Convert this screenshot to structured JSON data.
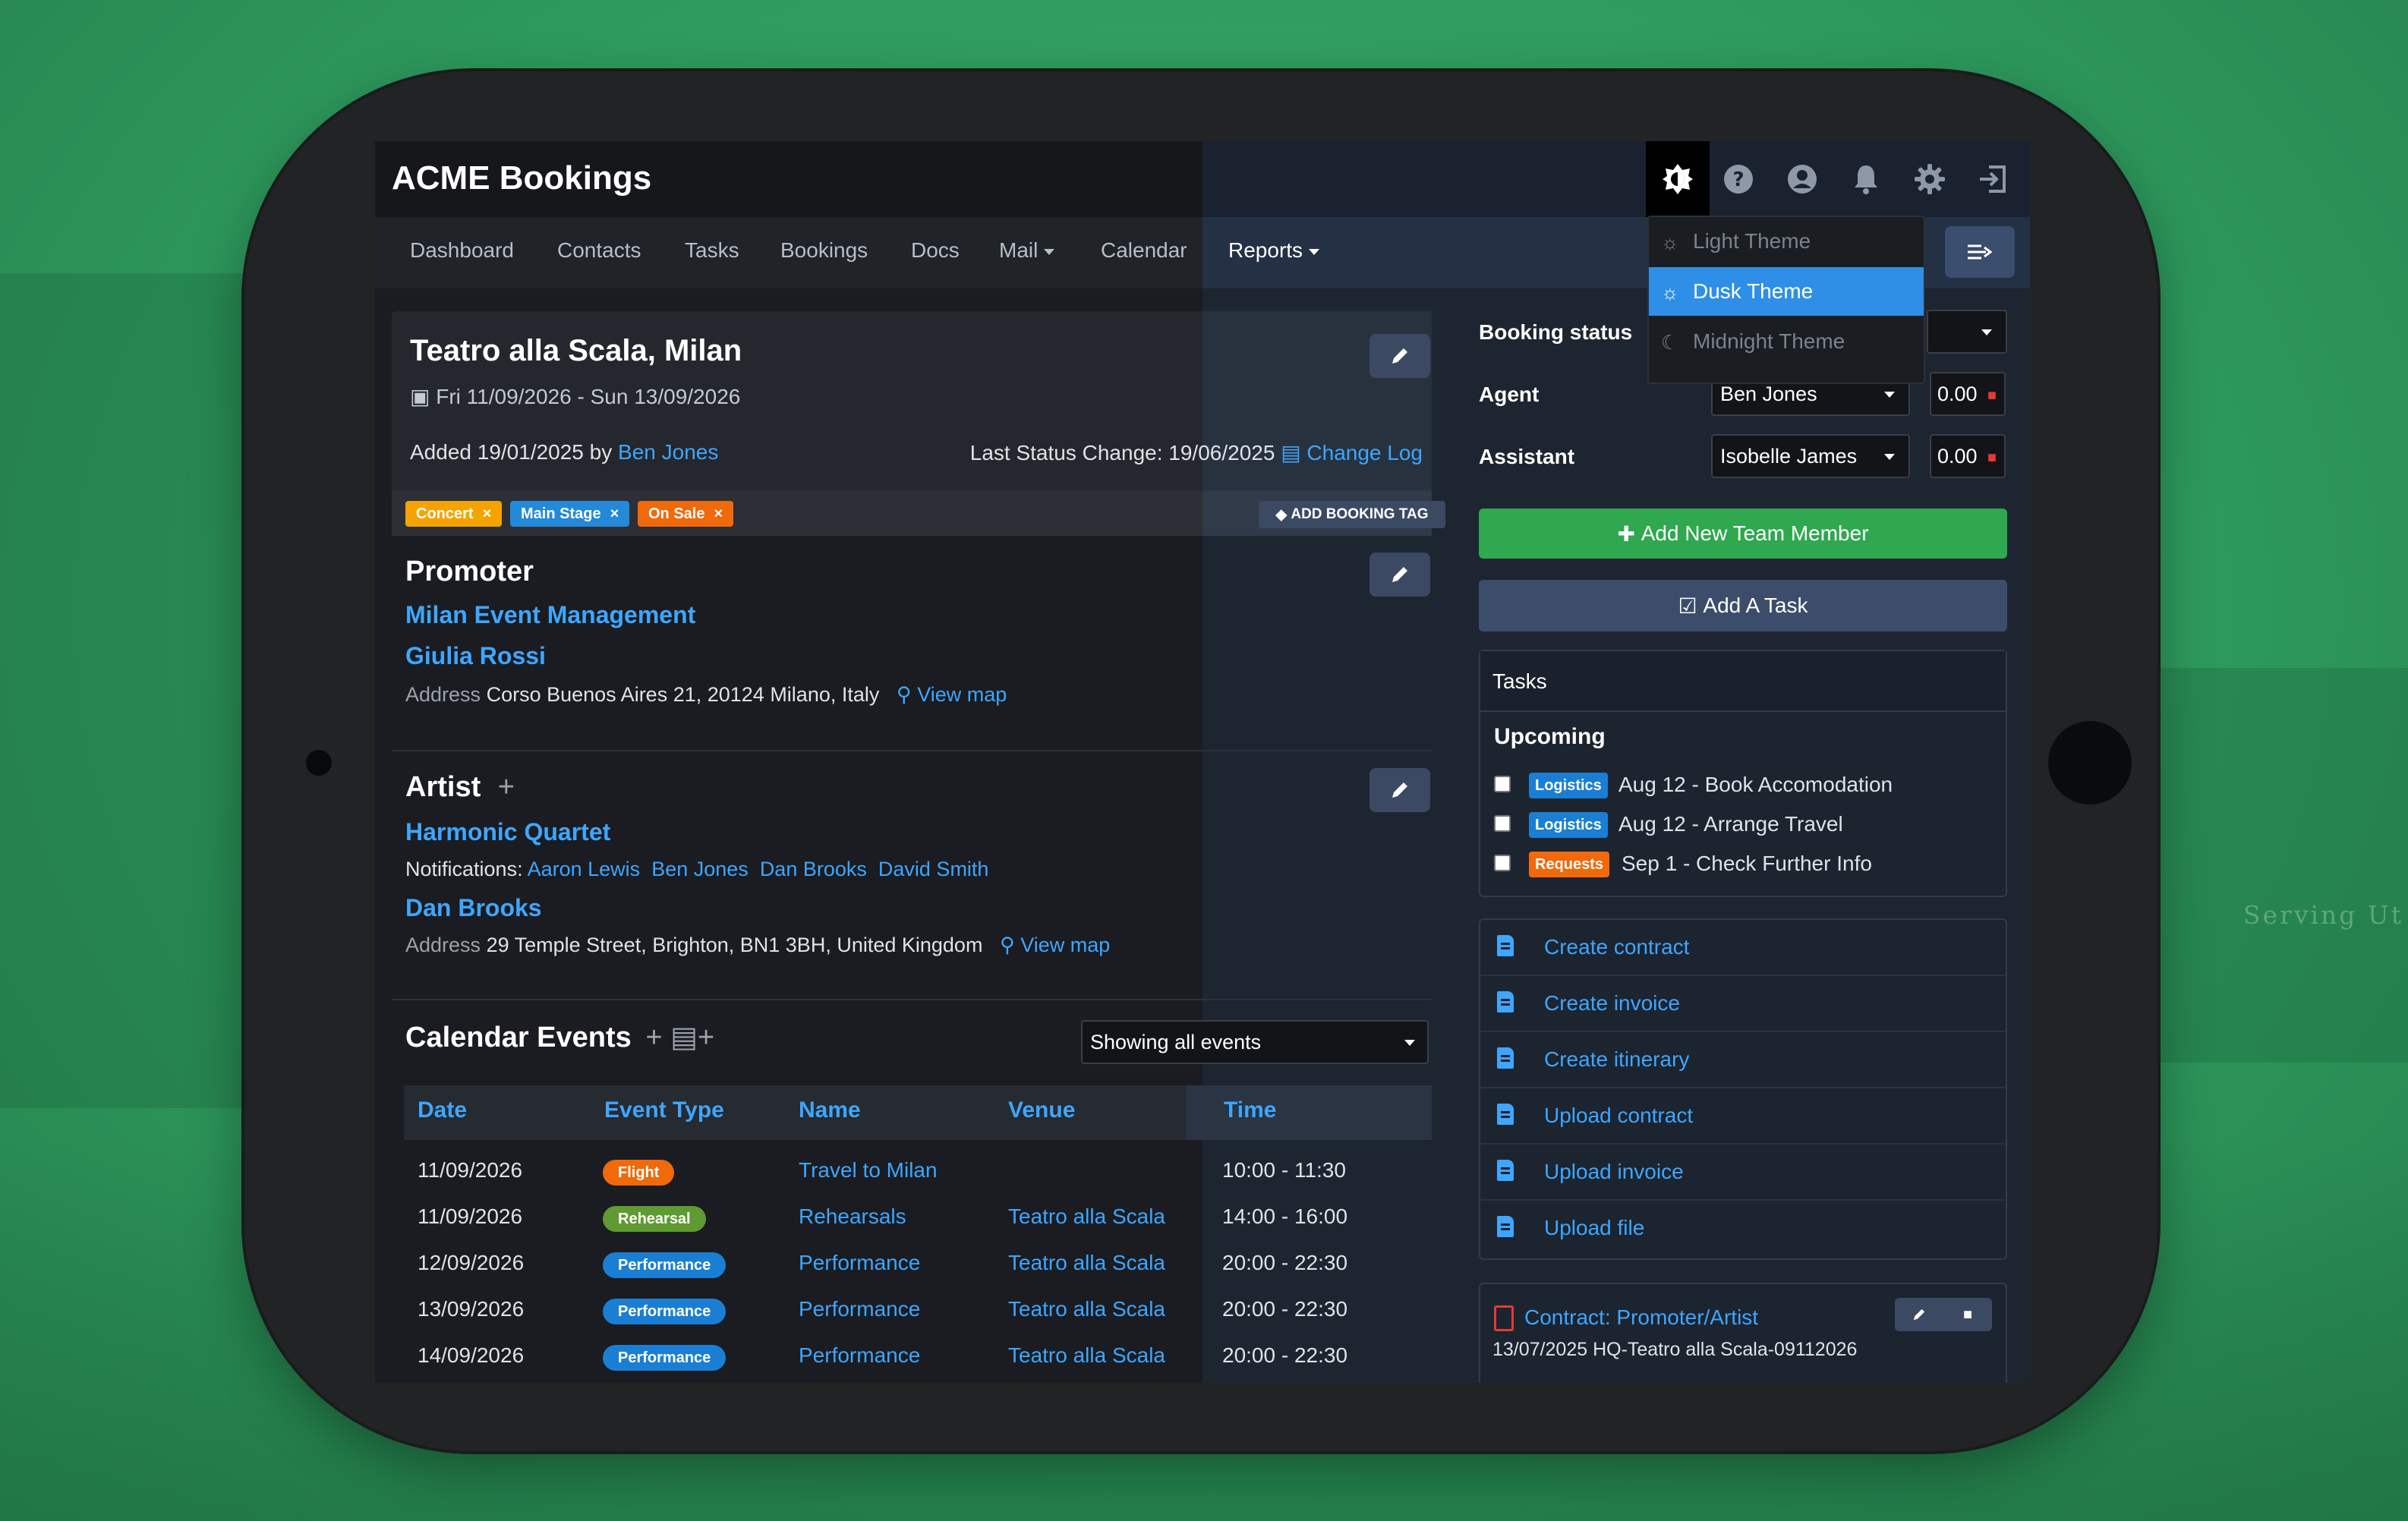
{
  "app": {
    "title": "ACME Bookings"
  },
  "header_icons": [
    "theme-icon",
    "help-icon",
    "user-icon",
    "bell-icon",
    "gear-icon",
    "logout-icon"
  ],
  "nav": {
    "items": [
      {
        "label": "Dashboard"
      },
      {
        "label": "Contacts"
      },
      {
        "label": "Tasks"
      },
      {
        "label": "Bookings"
      },
      {
        "label": "Docs"
      },
      {
        "label": "Mail"
      },
      {
        "label": "Calendar"
      },
      {
        "label": "Reports"
      }
    ]
  },
  "theme_menu": {
    "items": [
      {
        "label": "Light Theme"
      },
      {
        "label": "Dusk Theme",
        "selected": true
      },
      {
        "label": "Midnight Theme"
      }
    ]
  },
  "booking": {
    "title": "Teatro alla Scala, Milan",
    "dates": "Fri 11/09/2026 - Sun 13/09/2026",
    "added_prefix": "Added 19/01/2025 by",
    "added_by": "Ben Jones",
    "last_status": "Last Status Change: 19/06/2025",
    "change_log": "Change Log"
  },
  "tags": [
    {
      "label": "Concert",
      "color": "#f5a300"
    },
    {
      "label": "Main Stage",
      "color": "#2389d8"
    },
    {
      "label": "On Sale",
      "color": "#f0690a"
    }
  ],
  "add_tag_label": "ADD BOOKING TAG",
  "promoter": {
    "title": "Promoter",
    "company": "Milan Event Management",
    "contact": "Giulia Rossi",
    "address_label": "Address",
    "address": "Corso Buenos Aires 21, 20124 Milano, Italy",
    "view_map": "View map"
  },
  "artist": {
    "title": "Artist",
    "name": "Harmonic Quartet",
    "notifications_label": "Notifications:",
    "notifications": [
      "Aaron Lewis",
      "Ben Jones",
      "Dan Brooks",
      "David Smith"
    ],
    "contact": "Dan Brooks",
    "address_label": "Address",
    "address": "29 Temple Street, Brighton, BN1 3BH, United Kingdom",
    "view_map": "View map"
  },
  "calendar": {
    "title": "Calendar Events",
    "filter": "Showing all events",
    "columns": [
      "Date",
      "Event Type",
      "Name",
      "Venue",
      "Time"
    ],
    "rows": [
      {
        "date": "11/09/2026",
        "type": "Flight",
        "type_color": "#f0690a",
        "name": "Travel to Milan",
        "venue": "",
        "time": "10:00 - 11:30"
      },
      {
        "date": "11/09/2026",
        "type": "Rehearsal",
        "type_color": "#5f9a32",
        "name": "Rehearsals",
        "venue": "Teatro alla Scala",
        "time": "14:00 - 16:00"
      },
      {
        "date": "12/09/2026",
        "type": "Performance",
        "type_color": "#1a7fd4",
        "name": "Performance",
        "venue": "Teatro alla Scala",
        "time": "20:00 - 22:30"
      },
      {
        "date": "13/09/2026",
        "type": "Performance",
        "type_color": "#1a7fd4",
        "name": "Performance",
        "venue": "Teatro alla Scala",
        "time": "20:00 - 22:30"
      },
      {
        "date": "14/09/2026",
        "type": "Performance",
        "type_color": "#1a7fd4",
        "name": "Performance",
        "venue": "Teatro alla Scala",
        "time": "20:00 - 22:30"
      }
    ]
  },
  "side": {
    "booking_status_label": "Booking status",
    "agent_label": "Agent",
    "agent_value": "Ben Jones",
    "agent_amount": "0.00",
    "assistant_label": "Assistant",
    "assistant_value": "Isobelle James",
    "assistant_amount": "0.00",
    "add_team_member": "Add New Team Member",
    "add_task": "Add A Task"
  },
  "tasks": {
    "title": "Tasks",
    "upcoming_label": "Upcoming",
    "items": [
      {
        "badge": "Logistics",
        "badge_color": "#1a7fd4",
        "text": "Aug 12 - Book Accomodation"
      },
      {
        "badge": "Logistics",
        "badge_color": "#1a7fd4",
        "text": "Aug 12 - Arrange Travel"
      },
      {
        "badge": "Requests",
        "badge_color": "#f0690a",
        "text": "Sep 1 - Check Further Info"
      }
    ]
  },
  "doc_actions": [
    {
      "label": "Create contract"
    },
    {
      "label": "Create invoice"
    },
    {
      "label": "Create itinerary"
    },
    {
      "label": "Upload contract"
    },
    {
      "label": "Upload invoice"
    },
    {
      "label": "Upload file"
    }
  ],
  "contract": {
    "title": "Contract: Promoter/Artist",
    "subtitle": "13/07/2025 HQ-Teatro alla Scala-09112026"
  },
  "background_text": "Serving Ut"
}
